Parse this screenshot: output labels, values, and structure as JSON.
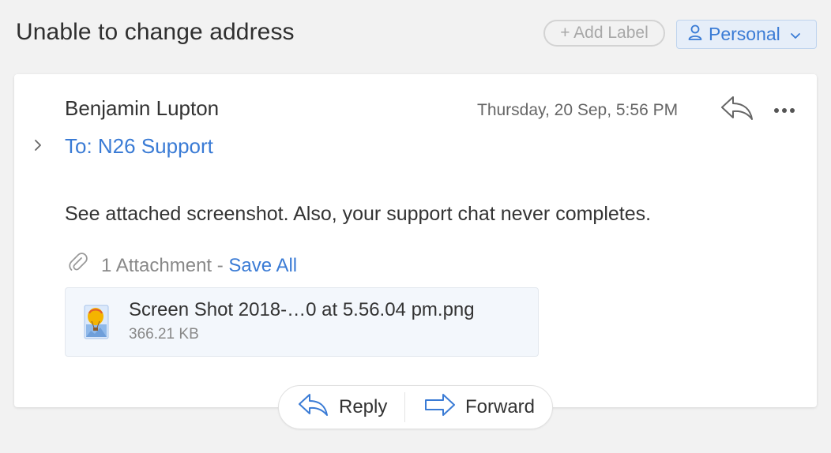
{
  "header": {
    "subject": "Unable to change address",
    "add_label": "+ Add Label",
    "folder": "Personal"
  },
  "message": {
    "sender": "Benjamin Lupton",
    "to": "To: N26 Support",
    "date": "Thursday, 20 Sep, 5:56 PM",
    "body": "See attached screenshot. Also, your support chat never completes.",
    "attachments_count_label": "1 Attachment -",
    "save_all": "Save All",
    "attachment": {
      "name": "Screen Shot 2018-…0 at 5.56.04 pm.png",
      "size": "366.21 KB"
    }
  },
  "actions": {
    "reply": "Reply",
    "forward": "Forward"
  },
  "icons": {
    "person": "person-icon",
    "chevron_down": "chevron-down-icon",
    "chevron_right": "chevron-right-icon",
    "reply": "reply-icon",
    "more": "more-icon",
    "paperclip": "paperclip-icon",
    "image_file": "image-file-icon",
    "forward": "forward-icon"
  },
  "colors": {
    "accent": "#3a7bd5",
    "background": "#f2f2f2",
    "card": "#ffffff"
  }
}
